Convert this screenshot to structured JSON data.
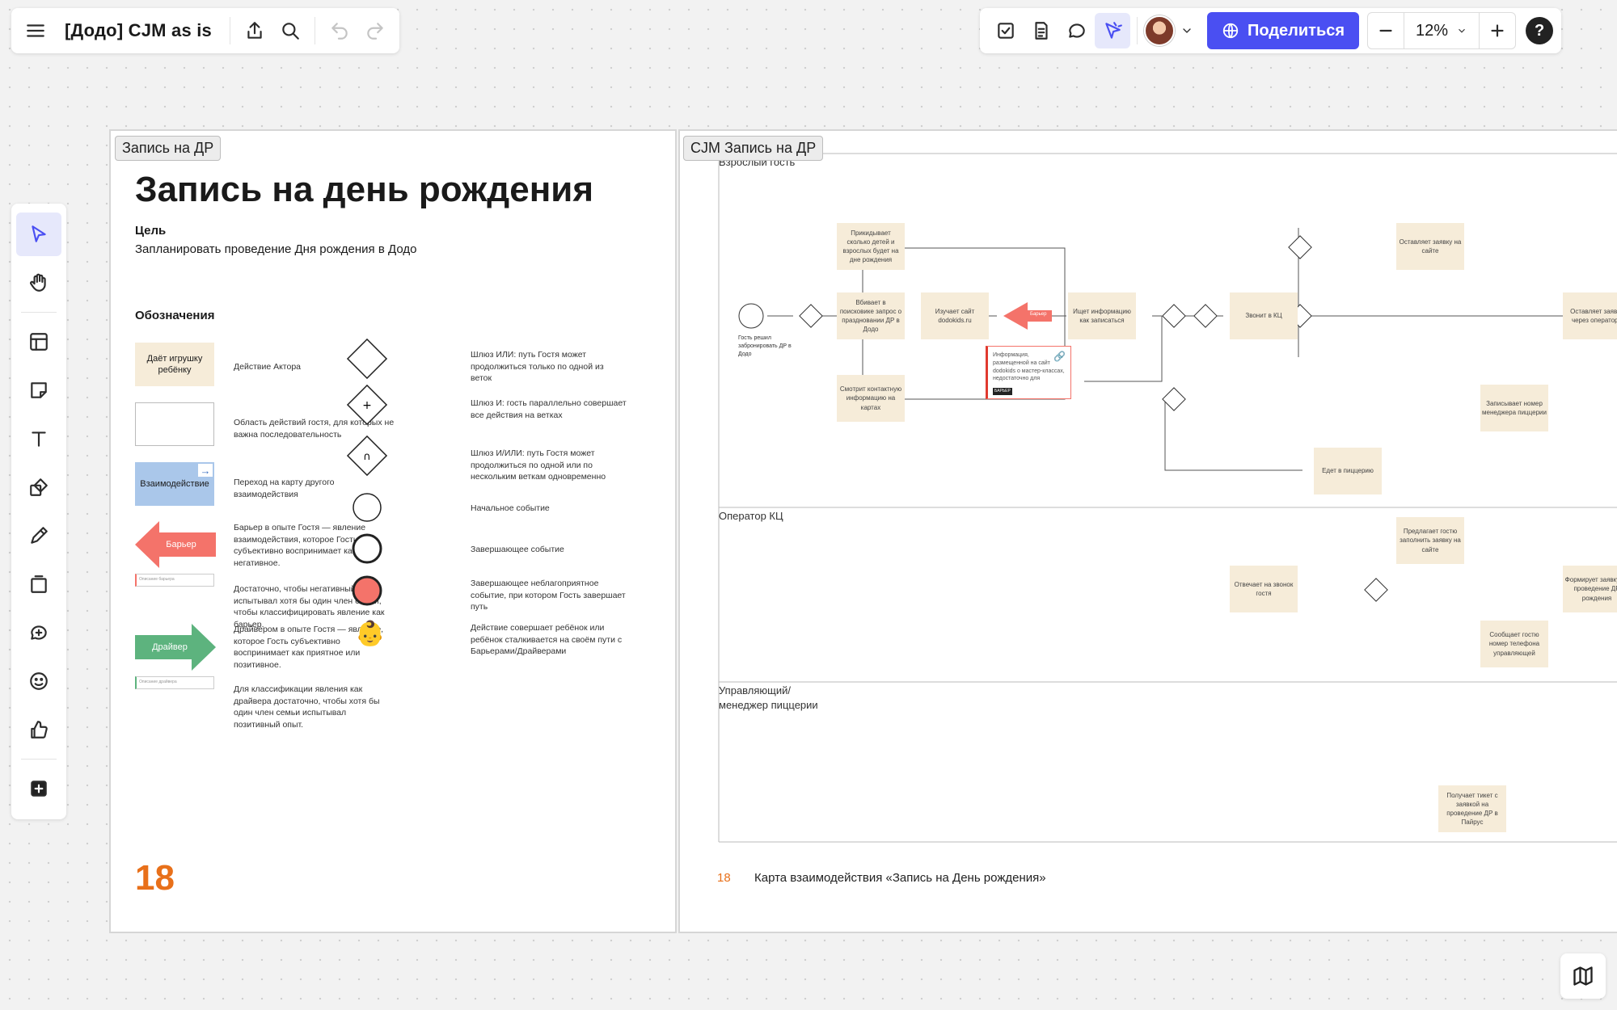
{
  "toolbar": {
    "doc_title": "[Додо] CJM as is",
    "share_label": "Поделиться",
    "zoom": "12%"
  },
  "colors": {
    "accent": "#4a4ff2",
    "page_number": "#e8701a",
    "actor_box": "#f6ecd9",
    "barrier": "#f4736a",
    "driver": "#5db37e",
    "interaction": "#aac7ea"
  },
  "frame1": {
    "label": "Запись на ДР",
    "title": "Запись на день рождения",
    "goal_label": "Цель",
    "goal_text": "Запланировать проведение Дня рождения в Додо",
    "legend_title": "Обозначения",
    "legend": {
      "actor_box": "Даёт игрушку ребёнку",
      "actor_desc": "Действие Актора",
      "area_desc": "Область действий гостя, для которых не важна последовательность",
      "interaction_box": "Взаимодействие",
      "interaction_desc": "Переход на карту другого взаимодействия",
      "barrier_box": "Барьер",
      "barrier_desc": "Барьер в опыте Гостя — явление взаимодействия, которое Гость субъективно воспринимает как негативное.",
      "barrier_desc2": "Достаточно, чтобы негативный опыт испытывал хотя бы один член семьи, чтобы классифицировать явление как барьер.",
      "barrier_note": "Описание барьера",
      "driver_box": "Драйвер",
      "driver_desc": "Драйвером в опыте Гостя — явление, которое Гость субъективно воспринимает как приятное или позитивное.",
      "driver_desc2": "Для классификации явления как драйвера достаточно, чтобы хотя бы один член семьи испытывал позитивный опыт.",
      "driver_note": "Описание драйвера",
      "gw_or": "Шлюз ИЛИ: путь Гостя может продолжиться только по одной из веток",
      "gw_and": "Шлюз И: гость параллельно совершает все действия на ветках",
      "gw_andor": "Шлюз И/ИЛИ: путь Гостя может продолжиться по одной или по нескольким веткам одновременно",
      "start_event": "Начальное событие",
      "end_event": "Завершающее событие",
      "end_bad": "Завершающее неблагоприятное событие, при котором Гость завершает путь",
      "child": "Действие совершает ребёнок или ребёнок сталкивается на своём пути с Барьерами/Драйверами"
    },
    "page_number": "18"
  },
  "frame2": {
    "label": "CJM Запись на ДР",
    "lane_guest": "Взрослый гость",
    "lane_operator": "Оператор КЦ",
    "lane_manager": "Управляющий/ менеджер пиццерии",
    "start_caption": "Гость решил забронировать ДР в Додо",
    "boxes": {
      "b1": "Прикидывает сколько детей и взрослых будет на дне рождения",
      "b2": "Вбивает в поисковике запрос о праздновании ДР в Додо",
      "b3": "Изучает сайт dodokids.ru",
      "b4": "Ищет информацию как записаться",
      "b5": "Смотрит контактную информацию на картах",
      "b6": "Звонит в КЦ",
      "b7": "Оставляет заявку на сайте",
      "b8": "Оставляет заявку через оператора",
      "b9": "Записывает номер менеджера пиццерии",
      "b10": "Едет в пиццерию",
      "b11": "Отвечает на звонок гостя",
      "b12": "Предлагает гостю заполнить заявку на сайте",
      "b13": "Формирует заявку на проведение ДР рождения",
      "b14": "Сообщает гостю номер телефона управляющей",
      "b15": "Получает тикет с заявкой на проведение ДР в Пайрус"
    },
    "barrier_label": "Барьер",
    "note_text": "Информация, размещенной на сайт dodokids о мастер-классах, недостаточно для",
    "note_tag": "БАРЬЕР",
    "footer_number": "18",
    "footer_text": "Карта взаимодействия «Запись на День рождения»"
  }
}
